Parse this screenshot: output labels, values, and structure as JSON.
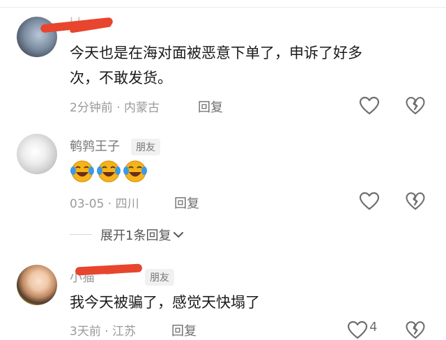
{
  "comments": [
    {
      "username": "l l",
      "text_line1": "今天也是在海对面被恶意下单了，申诉了好多",
      "text_line2": "次，不敢发货。",
      "time": "2分钟前",
      "location": "内蒙古",
      "reply_label": "回复"
    },
    {
      "username": "鹌鹑王子",
      "badge": "朋友",
      "emojis": [
        "laugh-cry-emoji",
        "laugh-cry-emoji",
        "laugh-cry-emoji"
      ],
      "time": "03-05",
      "location": "四川",
      "reply_label": "回复",
      "expand_label": "展开1条回复"
    },
    {
      "username": "小猫",
      "badge": "朋友",
      "text": "我今天被骗了，感觉天快塌了",
      "time": "3天前",
      "location": "江苏",
      "reply_label": "回复",
      "like_count": "4"
    }
  ],
  "separator": " · ",
  "colors": {
    "muted": "#9a9a9a",
    "scribble": "#e8452e",
    "badge_bg": "#f1f1f1"
  }
}
